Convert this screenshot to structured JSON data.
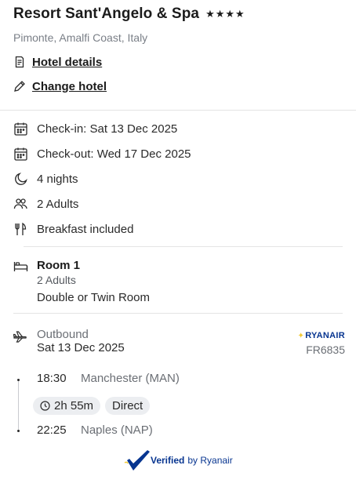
{
  "hotel": {
    "name": "Resort Sant'Angelo & Spa",
    "stars": "★★★★",
    "location": "Pimonte, Amalfi Coast, Italy",
    "details_link": "Hotel details",
    "change_link": "Change hotel"
  },
  "stay": {
    "checkin": "Check-in: Sat 13 Dec 2025",
    "checkout": "Check-out: Wed 17 Dec 2025",
    "nights": "4 nights",
    "guests": "2 Adults",
    "board": "Breakfast included"
  },
  "room": {
    "name": "Room 1",
    "guests": "2 Adults",
    "type": "Double or Twin Room"
  },
  "flight": {
    "direction": "Outbound",
    "date": "Sat 13 Dec 2025",
    "carrier": "RYANAIR",
    "number": "FR6835",
    "depart_time": "18:30",
    "depart_airport": "Manchester (MAN)",
    "duration": "2h 55m",
    "stops": "Direct",
    "arrive_time": "22:25",
    "arrive_airport": "Naples (NAP)"
  },
  "verified": {
    "label": "Verified",
    "by": "by Ryanair"
  },
  "colors": {
    "brand": "#073590",
    "accent": "#f1c933"
  }
}
